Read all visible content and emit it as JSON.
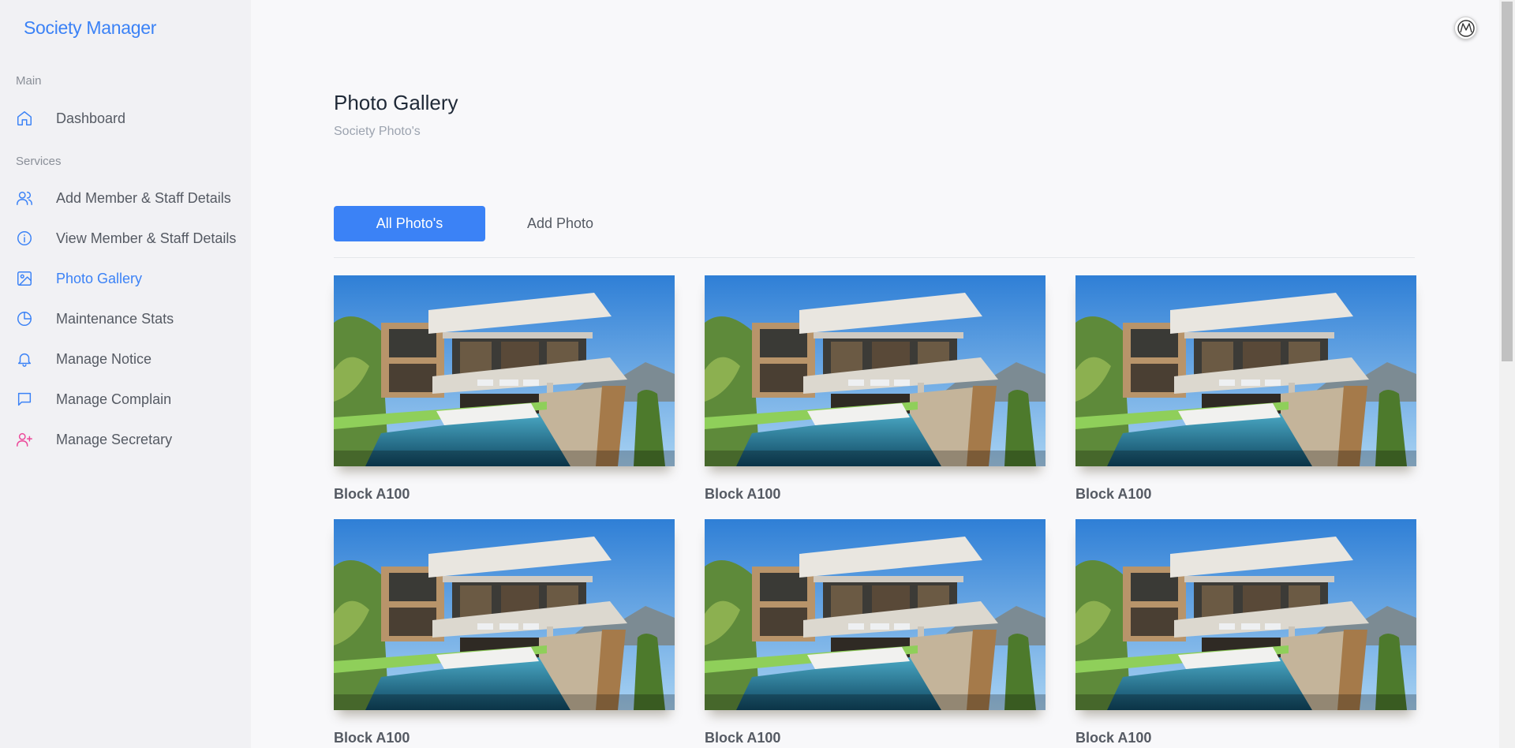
{
  "brand": "Society Manager",
  "sidebar": {
    "main_label": "Main",
    "services_label": "Services",
    "items": [
      {
        "label": "Dashboard",
        "icon": "home-icon"
      },
      {
        "label": "Add Member & Staff Details",
        "icon": "users-icon"
      },
      {
        "label": "View Member & Staff Details",
        "icon": "info-icon"
      },
      {
        "label": "Photo Gallery",
        "icon": "image-icon",
        "active": true
      },
      {
        "label": "Maintenance Stats",
        "icon": "pie-chart-icon"
      },
      {
        "label": "Manage Notice",
        "icon": "bell-icon"
      },
      {
        "label": "Manage Complain",
        "icon": "message-icon"
      },
      {
        "label": "Manage Secretary",
        "icon": "user-plus-icon"
      }
    ]
  },
  "page": {
    "title": "Photo Gallery",
    "subtitle": "Society Photo's"
  },
  "tabs": {
    "all": "All Photo's",
    "add": "Add Photo"
  },
  "gallery": [
    {
      "caption": "Block A100"
    },
    {
      "caption": "Block A100"
    },
    {
      "caption": "Block A100"
    },
    {
      "caption": "Block A100"
    },
    {
      "caption": "Block A100"
    },
    {
      "caption": "Block A100"
    }
  ],
  "colors": {
    "accent": "#3b82f6",
    "sidebar_bg": "#f1f1f4",
    "page_bg": "#f8f8fa"
  }
}
